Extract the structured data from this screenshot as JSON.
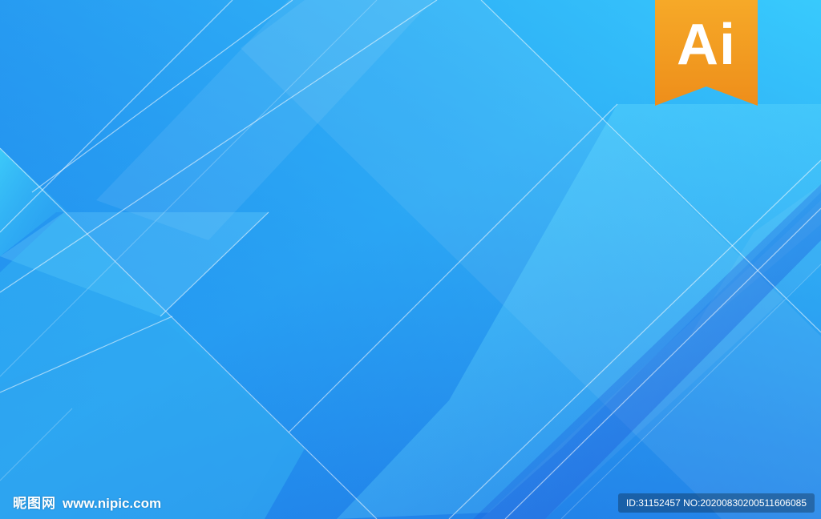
{
  "badge": {
    "text": "Ai",
    "color": "#F39A1E"
  },
  "watermark": {
    "brand": "昵图网",
    "url": "www.nipic.com",
    "id_text": "ID:31152457 NO:20200830200511606085"
  },
  "colors": {
    "background_top": "#1E8FE8",
    "background_bottom": "#1A6FE0",
    "accent_cyan": "#5BD8FA"
  }
}
